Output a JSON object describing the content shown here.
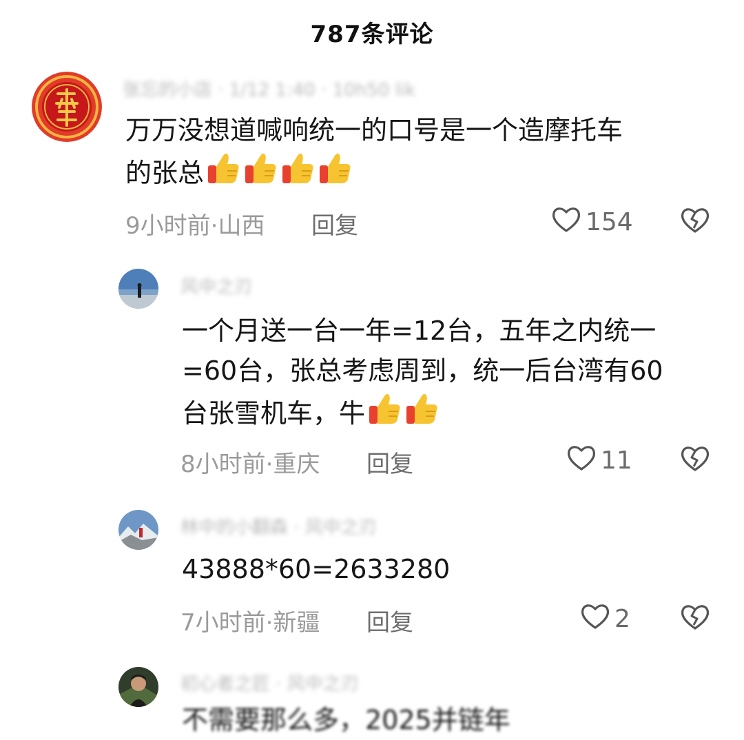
{
  "header": {
    "title": "787条评论"
  },
  "comments": [
    {
      "username": "张忘的小店 · 1/12 1:40 · 10h50 lik",
      "text_line1": "万万没想道喊响统一的口号是一个造摩托车",
      "text_line2": "的张总",
      "emoji_count": 4,
      "meta": "9小时前·山西",
      "reply_label": "回复",
      "likes": "154"
    },
    {
      "username": "风中之刃",
      "text_line1": "一个月送一台一年=12台，五年之内统一",
      "text_line2": "=60台，张总考虑周到，统一后台湾有60",
      "text_line3": "台张雪机车，牛",
      "emoji_count": 2,
      "meta": "8小时前·重庆",
      "reply_label": "回复",
      "likes": "11"
    },
    {
      "username": "林中的小翻森 · 风中之刃",
      "text_line1": "43888*60=2633280",
      "meta": "7小时前·新疆",
      "reply_label": "回复",
      "likes": "2"
    },
    {
      "username": "初心者之匠 · 风中之刃",
      "text_line1": "不需要那么多，2025并链年"
    }
  ],
  "icons": {
    "like": "heart-outline-icon",
    "dislike": "broken-heart-icon",
    "emoji": "thumbs-up-emoji"
  },
  "colors": {
    "avatar1_bg": "#d62a1f",
    "avatar1_ring": "#f2b640",
    "thumb_yellow": "#f7c431",
    "thumb_red": "#e8412f"
  }
}
